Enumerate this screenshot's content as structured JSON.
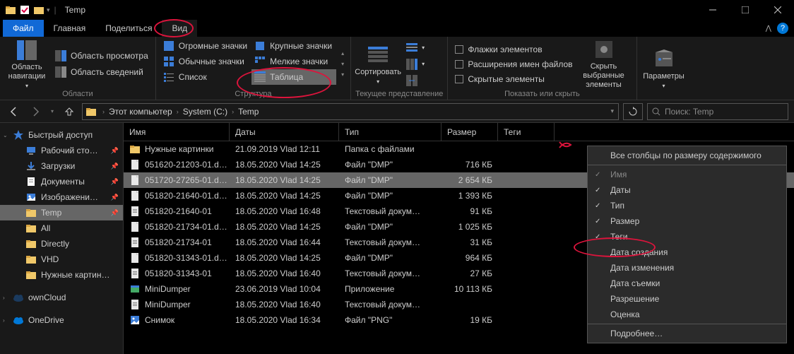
{
  "window": {
    "title": "Temp"
  },
  "menu": {
    "file": "Файл",
    "home": "Главная",
    "share": "Поделиться",
    "view": "Вид"
  },
  "ribbon": {
    "panes": {
      "nav": "Область навигации",
      "preview": "Область просмотра",
      "details": "Область сведений",
      "group": "Области"
    },
    "layouts": {
      "huge": "Огромные значки",
      "large": "Крупные значки",
      "normal": "Обычные значки",
      "small": "Мелкие значки",
      "list": "Список",
      "table": "Таблица",
      "group": "Структура"
    },
    "current": {
      "sort": "Сортировать",
      "group": "Текущее представление"
    },
    "showhide": {
      "flags": "Флажки элементов",
      "ext": "Расширения имен файлов",
      "hidden": "Скрытые элементы",
      "hidesel": "Скрыть выбранные элементы",
      "group": "Показать или скрыть"
    },
    "options": "Параметры"
  },
  "breadcrumb": {
    "segs": [
      "Этот компьютер",
      "System (C:)",
      "Temp"
    ]
  },
  "search": {
    "placeholder": "Поиск: Temp"
  },
  "sidebar": {
    "quick": "Быстрый доступ",
    "items": [
      {
        "label": "Рабочий сто…",
        "pin": true,
        "icon": "desktop"
      },
      {
        "label": "Загрузки",
        "pin": true,
        "icon": "downloads"
      },
      {
        "label": "Документы",
        "pin": true,
        "icon": "documents"
      },
      {
        "label": "Изображени…",
        "pin": true,
        "icon": "pictures"
      },
      {
        "label": "Temp",
        "pin": true,
        "icon": "folder",
        "active": true
      },
      {
        "label": "All",
        "pin": false,
        "icon": "folder"
      },
      {
        "label": "Directly",
        "pin": false,
        "icon": "folder"
      },
      {
        "label": "VHD",
        "pin": false,
        "icon": "folder"
      },
      {
        "label": "Нужные картин…",
        "pin": false,
        "icon": "folder"
      }
    ],
    "owncloud": "ownCloud",
    "onedrive": "OneDrive"
  },
  "columns": {
    "name": "Имя",
    "date": "Даты",
    "type": "Тип",
    "size": "Размер",
    "tags": "Теги"
  },
  "files": [
    {
      "icon": "folder",
      "name": "Нужные картинки",
      "date": "21.09.2019 Vlad 12:11",
      "type": "Папка с файлами",
      "size": ""
    },
    {
      "icon": "file",
      "name": "051620-21203-01.d…",
      "date": "18.05.2020 Vlad 14:25",
      "type": "Файл \"DMP\"",
      "size": "716 КБ"
    },
    {
      "icon": "file",
      "name": "051720-27265-01.d…",
      "date": "18.05.2020 Vlad 14:25",
      "type": "Файл \"DMP\"",
      "size": "2 654 КБ",
      "selected": true
    },
    {
      "icon": "file",
      "name": "051820-21640-01.d…",
      "date": "18.05.2020 Vlad 14:25",
      "type": "Файл \"DMP\"",
      "size": "1 393 КБ"
    },
    {
      "icon": "txt",
      "name": "051820-21640-01",
      "date": "18.05.2020 Vlad 16:48",
      "type": "Текстовый докум…",
      "size": "91 КБ"
    },
    {
      "icon": "file",
      "name": "051820-21734-01.d…",
      "date": "18.05.2020 Vlad 14:25",
      "type": "Файл \"DMP\"",
      "size": "1 025 КБ"
    },
    {
      "icon": "txt",
      "name": "051820-21734-01",
      "date": "18.05.2020 Vlad 16:44",
      "type": "Текстовый докум…",
      "size": "31 КБ"
    },
    {
      "icon": "file",
      "name": "051820-31343-01.d…",
      "date": "18.05.2020 Vlad 14:25",
      "type": "Файл \"DMP\"",
      "size": "964 КБ"
    },
    {
      "icon": "txt",
      "name": "051820-31343-01",
      "date": "18.05.2020 Vlad 16:40",
      "type": "Текстовый докум…",
      "size": "27 КБ"
    },
    {
      "icon": "app",
      "name": "MiniDumper",
      "date": "23.06.2019 Vlad 10:04",
      "type": "Приложение",
      "size": "10 113 КБ"
    },
    {
      "icon": "txt",
      "name": "MiniDumper",
      "date": "18.05.2020 Vlad 16:40",
      "type": "Текстовый докум…",
      "size": ""
    },
    {
      "icon": "png",
      "name": "Снимок",
      "date": "18.05.2020 Vlad 16:34",
      "type": "Файл \"PNG\"",
      "size": "19 КБ"
    }
  ],
  "ctx": {
    "fit": "Все столбцы по размеру содержимого",
    "name": "Имя",
    "date": "Даты",
    "type": "Тип",
    "size": "Размер",
    "tags": "Теги",
    "created": "Дата создания",
    "modified": "Дата изменения",
    "taken": "Дата съемки",
    "perm": "Разрешение",
    "rating": "Оценка",
    "more": "Подробнее…"
  }
}
